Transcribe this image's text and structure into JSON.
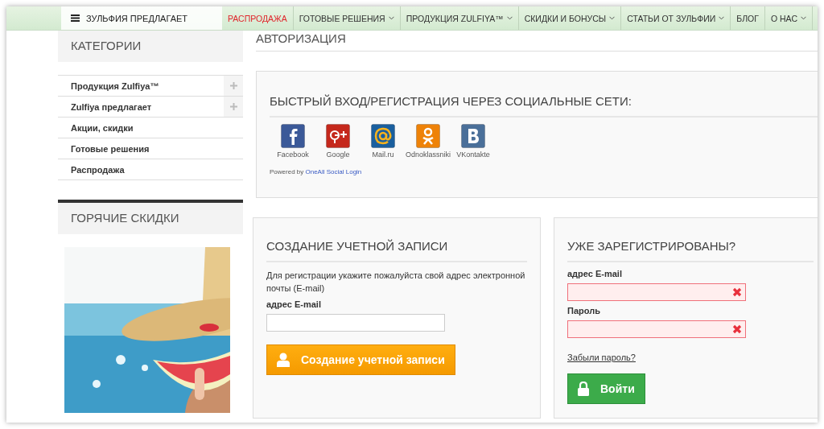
{
  "nav": {
    "menu_label": "ЗУЛЬФИЯ ПРЕДЛАГАЕТ",
    "items": [
      {
        "label": "РАСПРОДАЖА",
        "accent": true,
        "dropdown": false
      },
      {
        "label": "ГОТОВЫЕ РЕШЕНИЯ",
        "accent": false,
        "dropdown": true
      },
      {
        "label": "ПРОДУКЦИЯ ZULFIYA™",
        "accent": false,
        "dropdown": true
      },
      {
        "label": "СКИДКИ И БОНУСЫ",
        "accent": false,
        "dropdown": true
      },
      {
        "label": "СТАТЬИ ОТ ЗУЛЬФИИ",
        "accent": false,
        "dropdown": true
      },
      {
        "label": "БЛОГ",
        "accent": false,
        "dropdown": false
      },
      {
        "label": "О НАС",
        "accent": false,
        "dropdown": true
      }
    ]
  },
  "sidebar": {
    "categories_title": "КАТЕГОРИИ",
    "categories": [
      {
        "label": "Продукция Zulfiya™",
        "expandable": true
      },
      {
        "label": "Zulfiya предлагает",
        "expandable": true
      },
      {
        "label": "Акции, скидки",
        "expandable": false
      },
      {
        "label": "Готовые решения",
        "expandable": false
      },
      {
        "label": "Распродажа",
        "expandable": false
      }
    ],
    "hot_title": "ГОРЯЧИЕ СКИДКИ"
  },
  "page_title": "АВТОРИЗАЦИЯ",
  "social": {
    "title": "БЫСТРЫЙ ВХОД/РЕГИСТРАЦИЯ ЧЕРЕЗ СОЦИАЛЬНЫЕ СЕТИ:",
    "providers": [
      {
        "kind": "facebook",
        "label": "Facebook"
      },
      {
        "kind": "google",
        "label": "Google"
      },
      {
        "kind": "mailru",
        "label": "Mail.ru"
      },
      {
        "kind": "odnoklassniki",
        "label": "Odnoklassniki"
      },
      {
        "kind": "vkontakte",
        "label": "VKontakte"
      }
    ],
    "powered_prefix": "Powered by",
    "powered_link": "OneAll Social Login"
  },
  "create": {
    "title": "СОЗДАНИЕ УЧЕТНОЙ ЗАПИСИ",
    "text": "Для регистрации укажите пожалуйста свой адрес электронной почты (E-mail)",
    "email_label": "адрес E-mail",
    "button": "Создание учетной записи"
  },
  "login": {
    "title": "УЖЕ ЗАРЕГИСТРИРОВАНЫ?",
    "fields": [
      {
        "label": "адрес E-mail",
        "invalid": true
      },
      {
        "label": "Пароль",
        "invalid": true
      }
    ],
    "forgot": "Забыли пароль?",
    "button": "Войти"
  }
}
